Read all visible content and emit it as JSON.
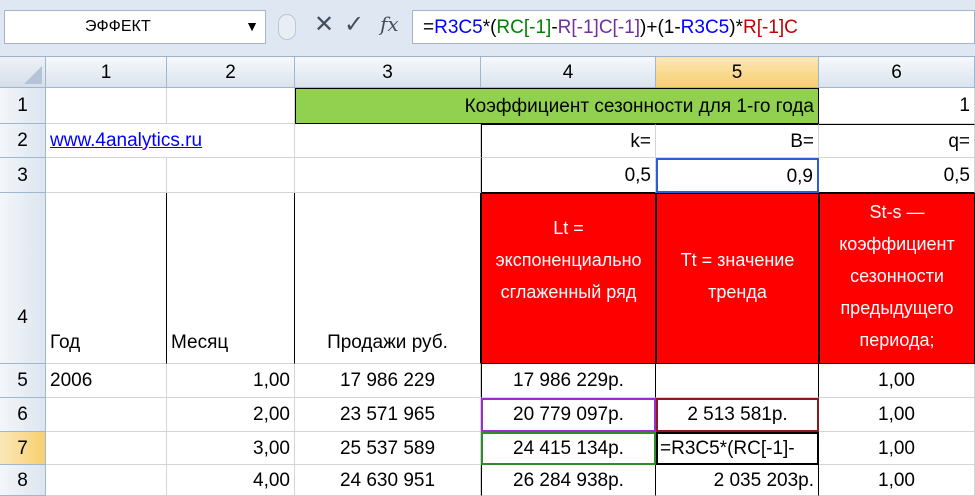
{
  "name_box": {
    "value": "ЭФФЕКТ"
  },
  "formula_bar": {
    "segments": [
      {
        "text": "=",
        "color": "#000000"
      },
      {
        "text": "R3C5",
        "color": "#0000ff"
      },
      {
        "text": "*(",
        "color": "#000000"
      },
      {
        "text": "RC[-1]",
        "color": "#008000"
      },
      {
        "text": "-",
        "color": "#000000"
      },
      {
        "text": "R[-1]C[-1]",
        "color": "#7030a0"
      },
      {
        "text": ")+(1-",
        "color": "#000000"
      },
      {
        "text": "R3C5",
        "color": "#0000ff"
      },
      {
        "text": ")*",
        "color": "#000000"
      },
      {
        "text": "R[-1]C",
        "color": "#c00000"
      }
    ]
  },
  "columns": [
    "1",
    "2",
    "3",
    "4",
    "5",
    "6"
  ],
  "rows": [
    "1",
    "2",
    "3",
    "4",
    "5",
    "6",
    "7",
    "8"
  ],
  "cells": {
    "r1_title": "Коэффициент сезонности для 1-го года",
    "r1_c6": "1",
    "r2_link": "www.4analytics.ru",
    "r2_c4": "k=",
    "r2_c5": "B=",
    "r2_c6": "q=",
    "r3_c4": "0,5",
    "r3_c5": "0,9",
    "r3_c6": "0,5",
    "r4_c1": "Год",
    "r4_c2": "Месяц",
    "r4_c3": "Продажи руб.",
    "r4_c4": "Lt = экспоненциально сглаженный ряд",
    "r4_c5": "Tt = значение тренда",
    "r4_c6": "St-s — коэффициент сезонности предыдущего периода;"
  },
  "data_rows": [
    {
      "year": "2006",
      "month": "1,00",
      "sales": "17 986 229",
      "lt": "17 986 229р.",
      "tt": "",
      "st": "1,00"
    },
    {
      "year": "",
      "month": "2,00",
      "sales": "23 571 965",
      "lt": "20 779 097р.",
      "tt": "2 513 581р.",
      "st": "1,00"
    },
    {
      "year": "",
      "month": "3,00",
      "sales": "25 537 589",
      "lt": "24 415 134р.",
      "tt": "=R3C5*(RC[-1]-",
      "st": "1,00"
    },
    {
      "year": "",
      "month": "4,00",
      "sales": "24 630 951",
      "lt": "26 284 938р.",
      "tt": "2 035 203р.",
      "st": "1,00"
    }
  ],
  "colors": {
    "title_bg": "#92d050",
    "header_red": "#ff0000",
    "selection": "#f8cf6e"
  }
}
